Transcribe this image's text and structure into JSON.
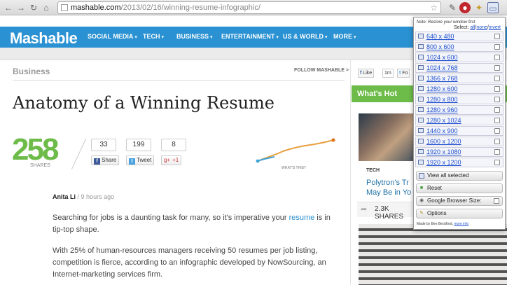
{
  "browser": {
    "url_host": "mashable.com",
    "url_path": "/2013/02/16/winning-resume-infographic/"
  },
  "site": {
    "logo": "Mashable",
    "nav": [
      "SOCIAL MEDIA",
      "TECH",
      "BUSINESS",
      "ENTERTAINMENT",
      "US & WORLD",
      "MORE"
    ],
    "nav_chevron": "▾"
  },
  "article": {
    "section": "Business",
    "follow": "FOLLOW MASHABLE >",
    "title": "Anatomy of a Winning Resume",
    "share_count": "258",
    "shares_label": "SHARES",
    "counts": [
      "33",
      "199",
      "8"
    ],
    "buttons": {
      "share": "Share",
      "tweet": "Tweet",
      "gplus": "+1",
      "gplus_icon": "g+"
    },
    "whats_this": "WHAT'S THIS?",
    "author": "Anita Li",
    "time": "9 hours ago",
    "author_sep": "/",
    "para1_a": "Searching for jobs is a daunting task for many, so it's imperative your ",
    "para1_link": "resume",
    "para1_b": " is in tip-top shape.",
    "para2": "With 25% of human-resources managers receiving 50 resumes per job listing, competition is fierce, according to an infographic developed by NowSourcing, an Internet-marketing services firm."
  },
  "sidebar": {
    "like": "Like",
    "like_count": "1m",
    "follow_partial": "Fo",
    "whats_hot": "What's Hot",
    "tag": "TECH",
    "hot_title": "Polytron's Tr May Be in Yo",
    "hot_shares": "2.3K SHARES"
  },
  "popup": {
    "note": "Note: Restore your window first",
    "select_label": "Select:",
    "select_all": "all",
    "select_none": "none",
    "select_invert": "invert",
    "resolutions": [
      "640 x 480",
      "800 x 600",
      "1024 x 600",
      "1024 x 768",
      "1366 x 768",
      "1280 x 600",
      "1280 x 800",
      "1280 x 960",
      "1280 x 1024",
      "1440 x 900",
      "1600 x 1200",
      "1920 x 1080",
      "1920 x 1200"
    ],
    "view_all": "View all selected",
    "reset": "Reset",
    "gbs": "Google Browser Size:",
    "options": "Options",
    "credit": "Made by Ben Beckford,",
    "more_info": "more info"
  },
  "colors": {
    "mashable_blue": "#2a91d2",
    "accent_green": "#6dbb48"
  }
}
